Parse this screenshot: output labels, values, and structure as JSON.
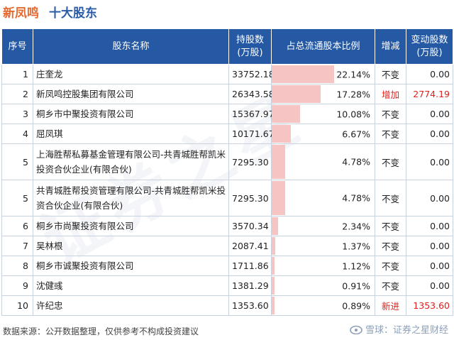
{
  "header": {
    "company": "新凤鸣",
    "title": "十大股东"
  },
  "table": {
    "columns": {
      "seq": "序号",
      "name": "股东名称",
      "hold_line1": "持股数",
      "hold_line2": "(万股)",
      "pct": "占总流通股本比例",
      "change": "增减",
      "delta_line1": "变动股数",
      "delta_line2": "(万股)"
    },
    "rows": [
      {
        "seq": "1",
        "name": "庄奎龙",
        "hold": "33752.18",
        "pct": "22.14%",
        "pct_value": 22.14,
        "change": "不变",
        "delta": "0.00",
        "up": false
      },
      {
        "seq": "2",
        "name": "新凤鸣控股集团有限公司",
        "hold": "26343.58",
        "pct": "17.28%",
        "pct_value": 17.28,
        "change": "增加",
        "delta": "2774.19",
        "up": true
      },
      {
        "seq": "3",
        "name": "桐乡市中聚投资有限公司",
        "hold": "15367.97",
        "pct": "10.08%",
        "pct_value": 10.08,
        "change": "不变",
        "delta": "0.00",
        "up": false
      },
      {
        "seq": "4",
        "name": "屈凤琪",
        "hold": "10171.67",
        "pct": "6.67%",
        "pct_value": 6.67,
        "change": "不变",
        "delta": "0.00",
        "up": false
      },
      {
        "seq": "5",
        "name": "上海胜帮私募基金管理有限公司-共青城胜帮凯米投资合伙企业(有限合伙)",
        "hold": "7295.30",
        "pct": "4.78%",
        "pct_value": 4.78,
        "change": "不变",
        "delta": "0.00",
        "up": false,
        "tall": true
      },
      {
        "seq": "5",
        "name": "共青城胜帮投资管理有限公司-共青城胜帮凯米投资合伙企业(有限合伙)",
        "hold": "7295.30",
        "pct": "4.78%",
        "pct_value": 4.78,
        "change": "不变",
        "delta": "0.00",
        "up": false,
        "tall": true
      },
      {
        "seq": "6",
        "name": "桐乡市尚聚投资有限公司",
        "hold": "3570.34",
        "pct": "2.34%",
        "pct_value": 2.34,
        "change": "不变",
        "delta": "0.00",
        "up": false
      },
      {
        "seq": "7",
        "name": "吴林根",
        "hold": "2087.41",
        "pct": "1.37%",
        "pct_value": 1.37,
        "change": "不变",
        "delta": "0.00",
        "up": false
      },
      {
        "seq": "8",
        "name": "桐乡市诚聚投资有限公司",
        "hold": "1711.86",
        "pct": "1.12%",
        "pct_value": 1.12,
        "change": "不变",
        "delta": "0.00",
        "up": false
      },
      {
        "seq": "9",
        "name": "沈健彧",
        "hold": "1381.29",
        "pct": "0.91%",
        "pct_value": 0.91,
        "change": "不变",
        "delta": "0.00",
        "up": false
      },
      {
        "seq": "10",
        "name": "许纪忠",
        "hold": "1353.60",
        "pct": "0.89%",
        "pct_value": 0.89,
        "change": "新进",
        "delta": "1353.60",
        "up": true
      }
    ]
  },
  "footer": {
    "source": "数据来源：公开数据整理，仅供参考不构成投资建议"
  },
  "brand": {
    "text": "雪球：证券之星财经",
    "icon": "snowball-logo-icon"
  },
  "watermark": {
    "text": "证券之星"
  },
  "colors": {
    "header_bg": "#2559a4",
    "bar": "#f7c4c4",
    "increase": "#e0201c",
    "company": "#e8692f",
    "title": "#2a5caa"
  }
}
